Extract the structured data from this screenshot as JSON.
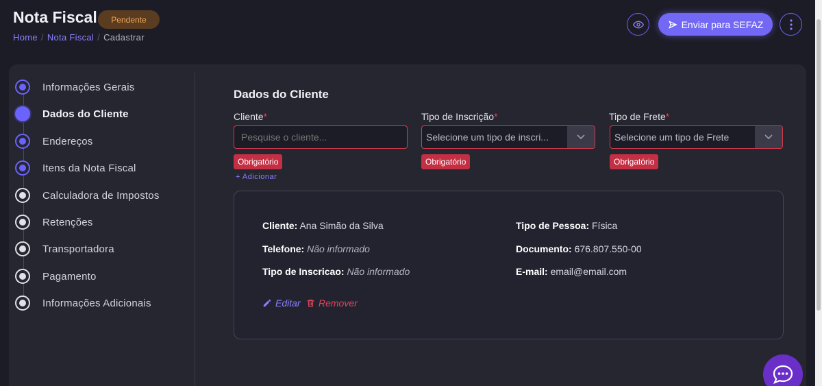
{
  "header": {
    "title": "Nota Fiscal",
    "status": "Pendente",
    "breadcrumb": [
      "Home",
      "Nota Fiscal",
      "Cadastrar"
    ],
    "send_label": "Enviar para SEFAZ"
  },
  "colors": {
    "accent": "#6b63ff",
    "error": "#c42f44",
    "pending": "#f2a552"
  },
  "steps": [
    {
      "label": "Informações Gerais",
      "state": "done"
    },
    {
      "label": "Dados do Cliente",
      "state": "active"
    },
    {
      "label": "Endereços",
      "state": "done"
    },
    {
      "label": "Itens da Nota Fiscal",
      "state": "done"
    },
    {
      "label": "Calculadora de Impostos",
      "state": "todo"
    },
    {
      "label": "Retenções",
      "state": "todo"
    },
    {
      "label": "Transportadora",
      "state": "todo"
    },
    {
      "label": "Pagamento",
      "state": "todo"
    },
    {
      "label": "Informações Adicionais",
      "state": "todo"
    }
  ],
  "section": {
    "title": "Dados do Cliente",
    "cliente": {
      "label": "Cliente",
      "required": "*",
      "placeholder": "Pesquise o cliente...",
      "error": "Obrigatório"
    },
    "inscricao": {
      "label": "Tipo de Inscrição",
      "required": "*",
      "value": "Selecione um tipo de inscri...",
      "error": "Obrigatório"
    },
    "frete": {
      "label": "Tipo de Frete",
      "required": "*",
      "value": "Selecione um tipo de Frete",
      "error": "Obrigatório"
    },
    "add_label": "+ Adicionar"
  },
  "client": {
    "cliente_label": "Cliente:",
    "cliente_value": "Ana Simão da Silva",
    "telefone_label": "Telefone:",
    "telefone_value": "Não informado",
    "inscricao_label": "Tipo de Inscricao:",
    "inscricao_value": "Não informado",
    "pessoa_label": "Tipo de Pessoa:",
    "pessoa_value": "Física",
    "documento_label": "Documento:",
    "documento_value": "676.807.550-00",
    "email_label": "E-mail:",
    "email_value": "email@email.com",
    "edit_label": "Editar",
    "remove_label": "Remover"
  }
}
